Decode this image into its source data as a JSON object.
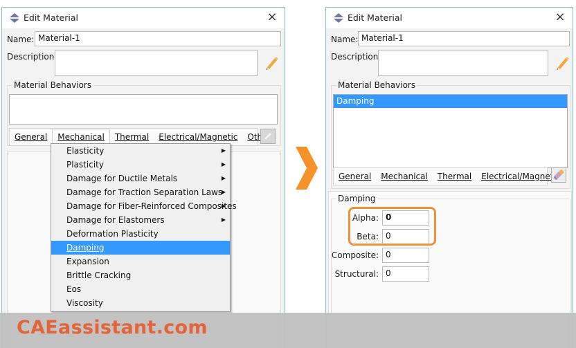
{
  "left_dialog": {
    "title": "Edit Material",
    "name_label": "Name:",
    "name_value": "Material-1",
    "description_label": "Description:",
    "description_value": "",
    "behaviors_group_title": "Material Behaviors",
    "behaviors": [],
    "tabs": [
      {
        "label": "General",
        "mnemonic_index": 0
      },
      {
        "label": "Mechanical",
        "mnemonic_index": 0,
        "active": true
      },
      {
        "label": "Thermal",
        "mnemonic_index": 0
      },
      {
        "label": "Electrical/Magnetic",
        "mnemonic_index": 0
      },
      {
        "label": "Other",
        "mnemonic_index": 0
      }
    ],
    "mechanical_menu": [
      {
        "label": "Elasticity",
        "submenu": true
      },
      {
        "label": "Plasticity",
        "submenu": true
      },
      {
        "label": "Damage for Ductile Metals",
        "submenu": true
      },
      {
        "label": "Damage for Traction Separation Laws",
        "submenu": true
      },
      {
        "label": "Damage for Fiber-Reinforced Composites",
        "submenu": true
      },
      {
        "label": "Damage for Elastomers",
        "submenu": true
      },
      {
        "label": "Deformation Plasticity",
        "submenu": false
      },
      {
        "label": "Damping",
        "submenu": false,
        "highlighted": true
      },
      {
        "label": "Expansion",
        "submenu": false
      },
      {
        "label": "Brittle Cracking",
        "submenu": false
      },
      {
        "label": "Eos",
        "submenu": false
      },
      {
        "label": "Viscosity",
        "submenu": false
      }
    ]
  },
  "right_dialog": {
    "title": "Edit Material",
    "name_label": "Name:",
    "name_value": "Material-1",
    "description_label": "Description:",
    "description_value": "",
    "behaviors_group_title": "Material Behaviors",
    "behaviors": [
      "Damping"
    ],
    "tabs": [
      {
        "label": "General"
      },
      {
        "label": "Mechanical"
      },
      {
        "label": "Thermal"
      },
      {
        "label": "Electrical/Magnetic"
      }
    ],
    "damping": {
      "group_title": "Damping",
      "fields": [
        {
          "label": "Alpha:",
          "value": "0"
        },
        {
          "label": "Beta:",
          "value": "0"
        },
        {
          "label": "Composite:",
          "value": "0"
        },
        {
          "label": "Structural:",
          "value": "0"
        }
      ]
    }
  },
  "icons": {
    "close": "×",
    "submenu_arrow": "▶"
  },
  "colors": {
    "accent_orange": "#f0923a",
    "selection_blue": "#3399ff",
    "watermark": "#e4643a"
  },
  "watermark": "CAEassistant.com"
}
